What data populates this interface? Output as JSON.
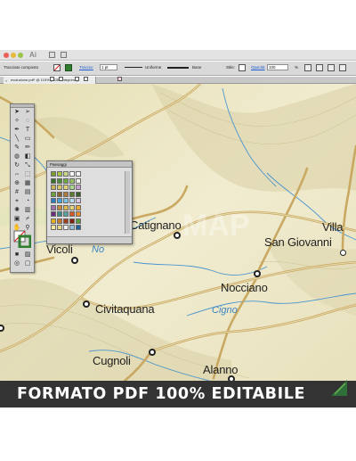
{
  "window": {
    "app_logo": "Ai",
    "colors": {
      "close": "#ec5f57",
      "minimize": "#e6b83b",
      "zoom": "#9ac446"
    }
  },
  "control_bar": {
    "selection_label": "Tracciato composto",
    "stroke_label": "Traccia:",
    "stroke_weight": "1 pt",
    "profile_value": "Uniforme",
    "brush_value": "Base",
    "style_label": "Stile:",
    "opacity_label": "Opacità",
    "opacity_value": "100",
    "percent": "%"
  },
  "document_tab": {
    "title": "evoluzione.pdf* @ 115% (RGB/Anteprima)",
    "close_icon": "close-icon"
  },
  "swatches_panel": {
    "title": "Paesaggi",
    "swatch_colors": [
      [
        "#7e9a32",
        "#a6c445",
        "#c8d68a",
        "#ffffff",
        "#f4f4f4"
      ],
      [
        "#3a6f2c",
        "#4f8a34",
        "#6ea843",
        "#96c060",
        "#f0efe4"
      ],
      [
        "#c9b45a",
        "#d7c46a",
        "#e3d37e",
        "#a8d88a",
        "#c8a0d0"
      ],
      [
        "#6f9f3a",
        "#8a6230",
        "#b07a3a",
        "#5a7b2a",
        "#3b5e2b"
      ],
      [
        "#2e7cc2",
        "#47a0d8",
        "#7cc2e6",
        "#b4e0f2",
        "#d9c5e6"
      ],
      [
        "#9f6fb0",
        "#c08a3a",
        "#e0b84a",
        "#e6d27a",
        "#f0a830"
      ],
      [
        "#6a2f7a",
        "#3e8a8a",
        "#5aa0a0",
        "#d45a2a",
        "#e88a2a"
      ],
      [
        "#e8b020",
        "#c77a2a",
        "#a04020",
        "#802010",
        "#5a9a3a"
      ],
      [
        "#f2e6a0",
        "#e8d880",
        "#f0f0f0",
        "#90c0e0",
        "#2060a0"
      ]
    ]
  },
  "map": {
    "places": [
      {
        "name": "Vicoli"
      },
      {
        "name": "Catignano"
      },
      {
        "name": "Villa"
      },
      {
        "name": "San Giovanni"
      },
      {
        "name": "Nocciano"
      },
      {
        "name": "Civitaquana"
      },
      {
        "name": "Cugnoli"
      },
      {
        "name": "Alanno"
      }
    ],
    "rivers": [
      {
        "name": "Cigno"
      },
      {
        "name": "No"
      }
    ],
    "colors": {
      "land": "#ede6c4",
      "road": "#c9a862",
      "water": "#4a95cf"
    }
  },
  "banner": {
    "text": "FORMATO PDF 100% EDITABILE"
  }
}
